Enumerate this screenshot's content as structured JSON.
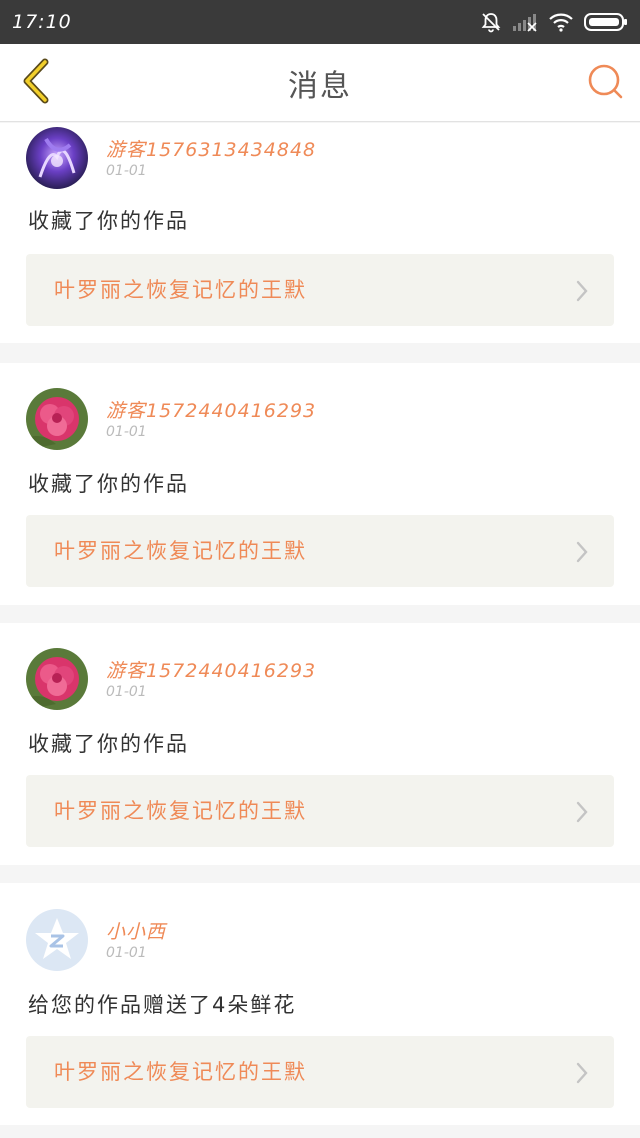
{
  "status_bar": {
    "time": "17:10",
    "icons": [
      "bell-muted-icon",
      "signal-icon",
      "wifi-icon",
      "battery-icon"
    ]
  },
  "header": {
    "title": "消息",
    "back_icon": "chevron-left-icon",
    "search_icon": "search-icon",
    "accent_color": "#ef8a57"
  },
  "messages": [
    {
      "avatar": "galaxy-avatar",
      "username": "游客1576313434848",
      "date": "01-01",
      "action": "收藏了你的作品",
      "work_title": "叶罗丽之恢复记忆的王默"
    },
    {
      "avatar": "flower-avatar",
      "username": "游客1572440416293",
      "date": "01-01",
      "action": "收藏了你的作品",
      "work_title": "叶罗丽之恢复记忆的王默"
    },
    {
      "avatar": "flower-avatar",
      "username": "游客1572440416293",
      "date": "01-01",
      "action": "收藏了你的作品",
      "work_title": "叶罗丽之恢复记忆的王默"
    },
    {
      "avatar": "default-qq-avatar",
      "username": "小小西",
      "date": "01-01",
      "action": "给您的作品赠送了4朵鲜花",
      "work_title": "叶罗丽之恢复记忆的王默"
    }
  ]
}
